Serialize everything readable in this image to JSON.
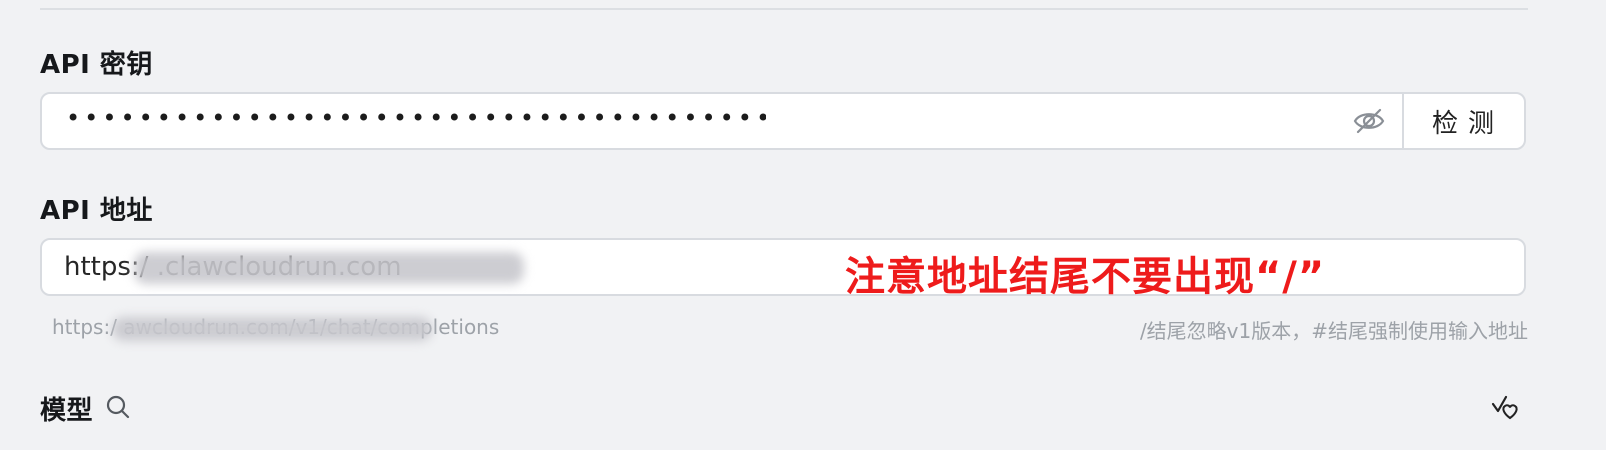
{
  "sections": {
    "api_key": {
      "label": "API 密钥",
      "masked_value": "••••••••••••••••••••••••••••••••••••••••••••••••",
      "visibility_icon": "eye-off-icon",
      "check_button_label": "检测"
    },
    "api_url": {
      "label": "API 地址",
      "value": "https:/                              .clawcloudrun.com",
      "annotation": "注意地址结尾不要出现“/”",
      "annotation_color": "#ee1b1b",
      "full_url_preview": "https:/                                      awcloudrun.com/v1/chat/completions",
      "hint": "/结尾忽略v1版本，#结尾强制使用输入地址"
    },
    "model": {
      "label": "模型",
      "search_icon": "search-icon",
      "action_icon": "check-heart-icon"
    }
  }
}
